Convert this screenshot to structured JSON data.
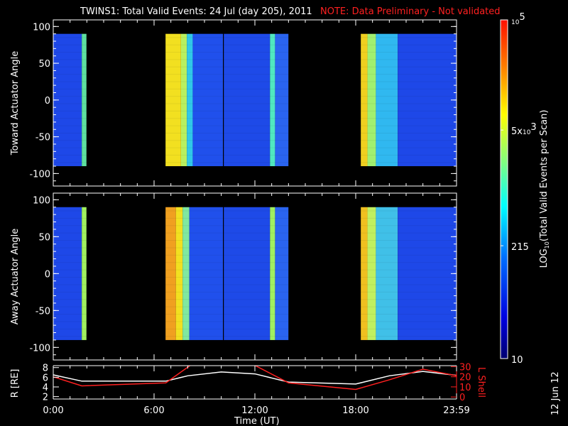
{
  "chart_data": {
    "type": "heatmap",
    "title": "TWINS1: Total Valid Events: 24 Jul (day 205), 2011",
    "note": "NOTE: Data Preliminary - Not validated",
    "xlabel": "Time (UT)",
    "x_ticks": [
      "0:00",
      "6:00",
      "12:00",
      "18:00",
      "23:59"
    ],
    "x_tick_hours": [
      0,
      6,
      12,
      18,
      24
    ],
    "xlim_hours": [
      0,
      24
    ],
    "panels": [
      {
        "ylabel": "Toward Actuator Angle",
        "y_ticks": [
          "100",
          "50",
          "0",
          "-50",
          "-100"
        ],
        "y_tick_values": [
          100,
          50,
          0,
          -50,
          -100
        ],
        "ylim": [
          -117,
          109
        ],
        "data_angle_range": [
          -90,
          90
        ],
        "strips": [
          {
            "start": 0.0,
            "end": 1.7,
            "color": "#1e48e8"
          },
          {
            "start": 1.7,
            "end": 1.98,
            "color": "#5ee0a0"
          },
          {
            "start": 6.68,
            "end": 7.6,
            "color": "#f2e020"
          },
          {
            "start": 7.6,
            "end": 7.95,
            "color": "#b8f060"
          },
          {
            "start": 7.95,
            "end": 8.3,
            "color": "#30c8e8"
          },
          {
            "start": 8.3,
            "end": 10.1,
            "color": "#2050ec"
          },
          {
            "start": 10.1,
            "end": 10.15,
            "color": "#000000"
          },
          {
            "start": 10.15,
            "end": 12.9,
            "color": "#1e4ae8"
          },
          {
            "start": 12.9,
            "end": 13.2,
            "color": "#50e8c0"
          },
          {
            "start": 13.2,
            "end": 14.0,
            "color": "#2a64f0"
          },
          {
            "start": 18.3,
            "end": 18.7,
            "color": "#f0d020"
          },
          {
            "start": 18.7,
            "end": 19.2,
            "color": "#a0f070"
          },
          {
            "start": 19.2,
            "end": 20.5,
            "color": "#30b8f0"
          },
          {
            "start": 20.5,
            "end": 24.0,
            "color": "#1e48e8"
          }
        ]
      },
      {
        "ylabel": "Away Actuator Angle",
        "y_ticks": [
          "100",
          "50",
          "0",
          "-50",
          "-100"
        ],
        "y_tick_values": [
          100,
          50,
          0,
          -50,
          -100
        ],
        "ylim": [
          -117,
          109
        ],
        "data_angle_range": [
          -90,
          90
        ],
        "strips": [
          {
            "start": 0.0,
            "end": 1.7,
            "color": "#1e48e8"
          },
          {
            "start": 1.7,
            "end": 1.98,
            "color": "#a0f060"
          },
          {
            "start": 6.68,
            "end": 7.3,
            "color": "#f0a020"
          },
          {
            "start": 7.3,
            "end": 7.7,
            "color": "#f2e020"
          },
          {
            "start": 7.7,
            "end": 8.1,
            "color": "#80e8a0"
          },
          {
            "start": 8.1,
            "end": 10.1,
            "color": "#2050ec"
          },
          {
            "start": 10.1,
            "end": 10.15,
            "color": "#000000"
          },
          {
            "start": 10.15,
            "end": 12.9,
            "color": "#1e4ae8"
          },
          {
            "start": 12.9,
            "end": 13.2,
            "color": "#a0f060"
          },
          {
            "start": 13.2,
            "end": 14.0,
            "color": "#2a64f0"
          },
          {
            "start": 18.3,
            "end": 18.7,
            "color": "#f0c020"
          },
          {
            "start": 18.7,
            "end": 19.2,
            "color": "#c0f060"
          },
          {
            "start": 19.2,
            "end": 20.5,
            "color": "#40c0e8"
          },
          {
            "start": 20.5,
            "end": 24.0,
            "color": "#1e48e8"
          }
        ]
      }
    ],
    "colorbar": {
      "label": "LOG10(Total Valid Events per Scan)",
      "label_main": "LOG",
      "label_sub": "10",
      "label_rest": "(Total Valid Events per Scan)",
      "range": [
        10,
        100000
      ],
      "ticks": [
        {
          "value": 100000,
          "base": "10",
          "exp": "5",
          "prefix": ""
        },
        {
          "value": 5000,
          "base": "10",
          "exp": "3",
          "prefix": "5x"
        },
        {
          "value": 215,
          "base": "215",
          "exp": "",
          "prefix": ""
        },
        {
          "value": 10,
          "base": "10",
          "exp": "",
          "prefix": ""
        }
      ]
    },
    "orbit": {
      "left_label": "R [RE]",
      "left_label_main": "R [R",
      "left_label_sub": "E",
      "left_label_end": "]",
      "left_ticks": [
        "8",
        "6",
        "4",
        "2"
      ],
      "left_tick_values": [
        8,
        6,
        4,
        2
      ],
      "left_lim": [
        1.5,
        8.4
      ],
      "right_label": "L Shell",
      "right_ticks": [
        "30",
        "20",
        "10",
        "0"
      ],
      "right_tick_values": [
        30,
        20,
        10,
        0
      ],
      "right_lim": [
        -2,
        31
      ],
      "R_series": {
        "hours": [
          0,
          1.7,
          6.7,
          8,
          10,
          12,
          14,
          16,
          18,
          20,
          22,
          24
        ],
        "values": [
          6.5,
          5.2,
          5.2,
          6.3,
          7.1,
          6.7,
          5.0,
          4.8,
          4.6,
          6.3,
          7.2,
          6.4
        ]
      },
      "L_series": {
        "hours": [
          0,
          1.7,
          6.7,
          8.3,
          11.8,
          14,
          18,
          20,
          22,
          24
        ],
        "values": [
          20,
          11,
          14,
          33,
          33,
          14,
          7.5,
          17,
          27.5,
          21
        ]
      }
    },
    "date_stamp": "12 Jun 12",
    "colors": {
      "R": "#ffffff",
      "L": "#ff2020",
      "note": "#ff2020",
      "axis": "#ffffff"
    }
  }
}
